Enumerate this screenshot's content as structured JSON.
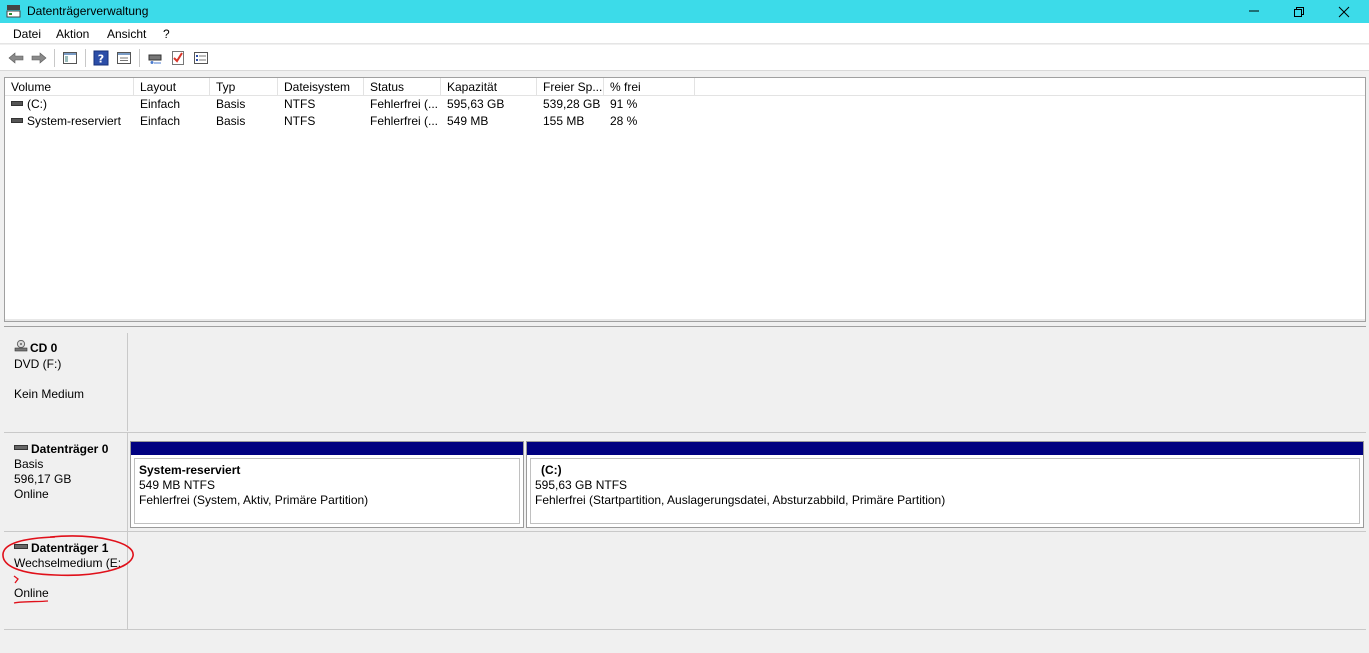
{
  "window": {
    "title": "Datenträgerverwaltung",
    "icon": "disk-management-icon"
  },
  "menu": [
    "Datei",
    "Aktion",
    "Ansicht",
    "?"
  ],
  "toolbar": {
    "icons": [
      "back-arrow-icon",
      "forward-arrow-icon",
      "console-tree-icon",
      "help-icon",
      "properties-icon",
      "rescan-disks-icon",
      "check-icon",
      "settings-list-icon"
    ]
  },
  "volume_list": {
    "columns": [
      "Volume",
      "Layout",
      "Typ",
      "Dateisystem",
      "Status",
      "Kapazität",
      "Freier Sp...",
      "% frei"
    ],
    "rows": [
      {
        "volume": "(C:)",
        "layout": "Einfach",
        "typ": "Basis",
        "dateisystem": "NTFS",
        "status": "Fehlerfrei (...",
        "kapazitaet": "595,63 GB",
        "frei": "539,28 GB",
        "prozent": "91 %"
      },
      {
        "volume": "System-reserviert",
        "layout": "Einfach",
        "typ": "Basis",
        "dateisystem": "NTFS",
        "status": "Fehlerfrei (...",
        "kapazitaet": "549 MB",
        "frei": "155 MB",
        "prozent": "28 %"
      }
    ]
  },
  "disks": [
    {
      "name": "CD 0",
      "lines": [
        "DVD (F:)",
        "Kein Medium"
      ]
    },
    {
      "name": "Datenträger 0",
      "lines": [
        "Basis",
        "596,17 GB",
        "Online"
      ],
      "partitions": [
        {
          "name": "System-reserviert",
          "size": "549 MB NTFS",
          "status": "Fehlerfrei (System, Aktiv, Primäre Partition)"
        },
        {
          "name": "(C:)",
          "size": "595,63 GB NTFS",
          "status": "Fehlerfrei (Startpartition, Auslagerungsdatei, Absturzabbild, Primäre Partition)"
        }
      ]
    },
    {
      "name": "Datenträger 1",
      "lines": [
        "Wechselmedium (E:",
        "Online"
      ]
    }
  ],
  "colors": {
    "titlebar": "#3cdbe9",
    "partition_bar": "#000080",
    "annotation": "#e0101a"
  }
}
